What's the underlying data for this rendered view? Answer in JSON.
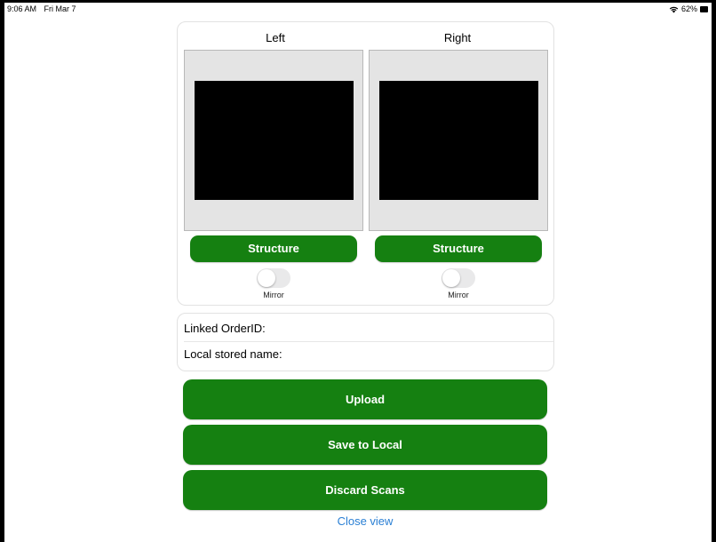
{
  "status_bar": {
    "time": "9:06 AM",
    "date": "Fri Mar 7",
    "battery": "62%",
    "wifi_icon": "wifi-icon",
    "battery_icon": "battery-icon"
  },
  "scan_panel": {
    "left": {
      "label": "Left",
      "structure_label": "Structure",
      "mirror_label": "Mirror",
      "mirror_on": false
    },
    "right": {
      "label": "Right",
      "structure_label": "Structure",
      "mirror_label": "Mirror",
      "mirror_on": false
    }
  },
  "info": {
    "linked_order_label": "Linked OrderID:",
    "local_name_label": "Local stored name:"
  },
  "actions": {
    "upload": "Upload",
    "save_local": "Save to Local",
    "discard": "Discard Scans",
    "close": "Close view"
  },
  "colors": {
    "button_green": "#158011",
    "link_blue": "#2a7fd4",
    "scan_bg": "#e4e4e4"
  }
}
